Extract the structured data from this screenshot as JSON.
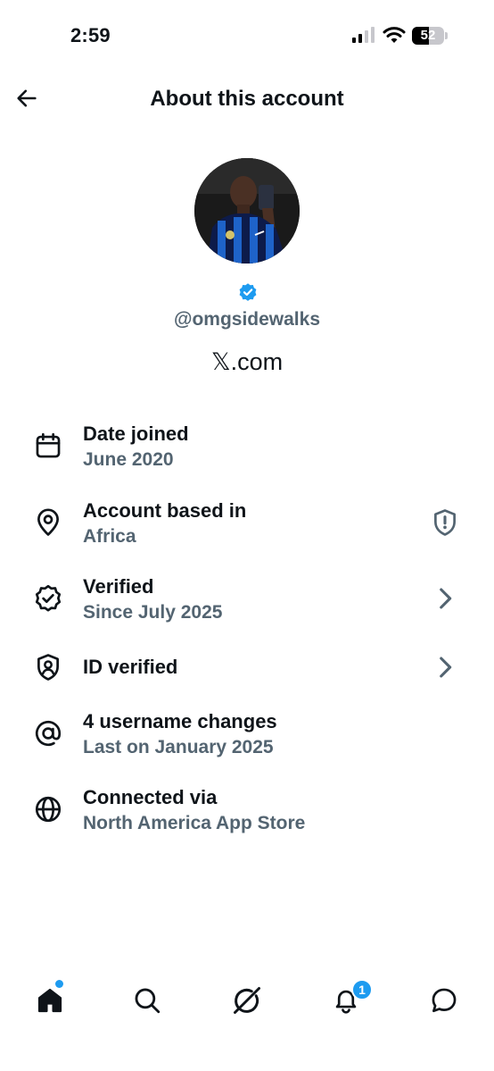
{
  "status_bar": {
    "time": "2:59",
    "battery_level": "52",
    "icons": [
      "signal-icon",
      "wifi-icon",
      "battery-icon"
    ]
  },
  "header": {
    "title": "About this account",
    "back_icon": "arrow-left-icon"
  },
  "profile": {
    "handle": "@omgsidewalks",
    "site": "𝕏.com",
    "verified_badge_color": "#1d9bf0"
  },
  "details": [
    {
      "icon": "calendar-icon",
      "title": "Date joined",
      "subtitle": "June 2020",
      "trailing": ""
    },
    {
      "icon": "location-pin-icon",
      "title": "Account based in",
      "subtitle": "Africa",
      "trailing": "shield-alert-icon"
    },
    {
      "icon": "verified-badge-icon",
      "title": "Verified",
      "subtitle": "Since July 2025",
      "trailing": "chevron-right-icon"
    },
    {
      "icon": "id-shield-icon",
      "title": "ID verified",
      "subtitle": "",
      "trailing": "chevron-right-icon"
    },
    {
      "icon": "at-sign-icon",
      "title": "4 username changes",
      "subtitle": "Last on January 2025",
      "trailing": ""
    },
    {
      "icon": "globe-icon",
      "title": "Connected via",
      "subtitle": "North America App Store",
      "trailing": ""
    }
  ],
  "tab_bar": {
    "tabs": [
      "home-icon",
      "search-icon",
      "grok-icon",
      "notifications-icon",
      "messages-icon"
    ],
    "notification_count": "1"
  },
  "colors": {
    "text_primary": "#0f1419",
    "text_secondary": "#536471",
    "accent": "#1d9bf0"
  }
}
